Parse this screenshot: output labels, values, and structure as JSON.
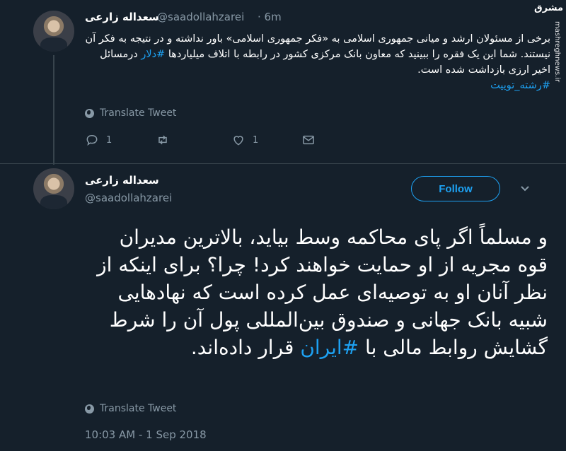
{
  "tweet1": {
    "name": "سعداله زارعی",
    "handle": "@saadollahzarei",
    "time": "· 6m",
    "text_before": "برخی از مسئولان ارشد و میانی جمهوری اسلامی به «فکر جمهوری اسلامی» باور نداشته و در نتیجه به فکر آن نیستند. شما این یک فقره را ببینید که معاون بانک مرکزی کشور در رابطه با اتلاف میلیاردها ",
    "hashtag1": "#دلار",
    "text_after": " درمسائل اخیر ارزی بازداشت شده است.",
    "hashtag2": "#رشته_توییت",
    "translate": "Translate Tweet",
    "reply_count": "1",
    "like_count": "1"
  },
  "tweet2": {
    "name": "سعداله زارعی",
    "handle": "@saadollahzarei",
    "follow_label": "Follow",
    "text_before": "و مسلماً اگر پای محاکمه وسط بیاید، بالاترین مدیران قوه مجریه از او حمایت خواهند کرد! چرا؟ برای اینکه از نظر آنان او به توصیه‌ای عمل کرده است که نهادهایی شبیه بانک جهانی و صندوق بین‌المللی پول آن را شرط گشایش روابط مالی با ",
    "hashtag": "#ایران",
    "text_after": " قرار داده‌اند.",
    "translate": "Translate Tweet",
    "timestamp": "10:03 AM - 1 Sep 2018"
  },
  "watermark": {
    "logo": "مشرق",
    "site": "mashreghnews.ir"
  },
  "colors": {
    "background": "#15202b",
    "accent": "#1da1f2",
    "muted": "#8899a6",
    "divider": "#38444d"
  }
}
